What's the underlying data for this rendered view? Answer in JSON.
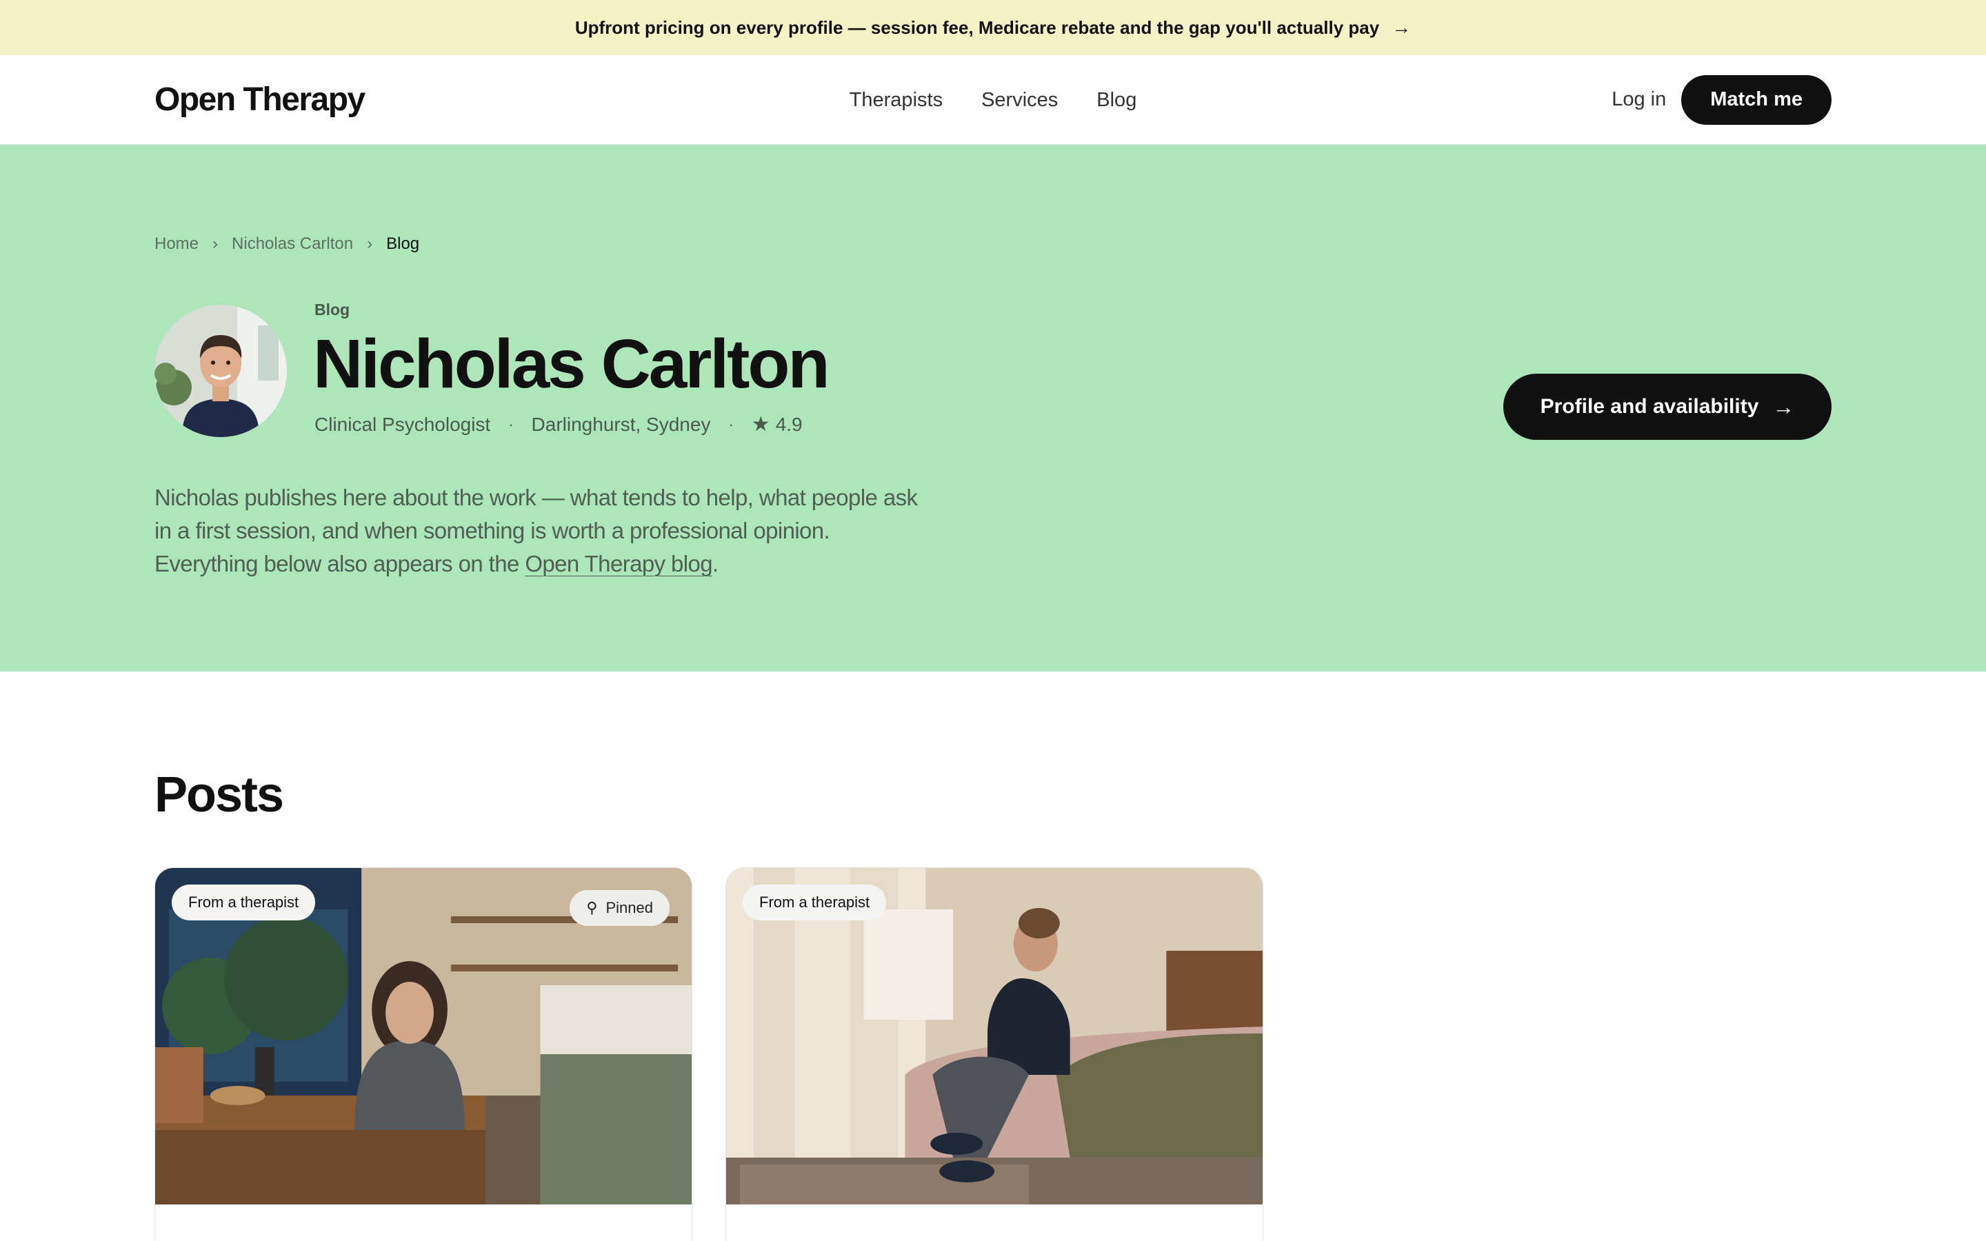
{
  "announcement": {
    "text": "Upfront pricing on every profile — session fee, Medicare rebate and the gap you'll actually pay",
    "arrow": "→"
  },
  "nav": {
    "logo": "Open Therapy",
    "links": [
      "Therapists",
      "Services",
      "Blog"
    ],
    "login": "Log in",
    "cta": "Match me"
  },
  "breadcrumb": {
    "items": [
      "Home",
      "Nicholas Carlton",
      "Blog"
    ],
    "separator": "›"
  },
  "profile": {
    "eyebrow": "Blog",
    "name": "Nicholas Carlton",
    "role": "Clinical Psychologist",
    "location": "Darlinghurst, Sydney",
    "rating": "4.9",
    "rating_icon": "star-icon",
    "meta_separator": "·",
    "intro_before": "Nicholas publishes here about the work — what tends to help, what people ask in a first session, and when something is worth a professional opinion. Everything below also appears on the ",
    "intro_link": "Open Therapy blog",
    "intro_after": ".",
    "cta": "Profile and availability",
    "cta_arrow": "→"
  },
  "posts": {
    "title": "Posts",
    "cards": [
      {
        "badge": "From a therapist",
        "pinned": "Pinned",
        "pin_icon": "pin-icon"
      },
      {
        "badge": "From a therapist"
      }
    ]
  },
  "colors": {
    "hero_bg": "#ade6b9",
    "announcement_bg": "#f3f3c6",
    "button_bg": "#111111"
  }
}
